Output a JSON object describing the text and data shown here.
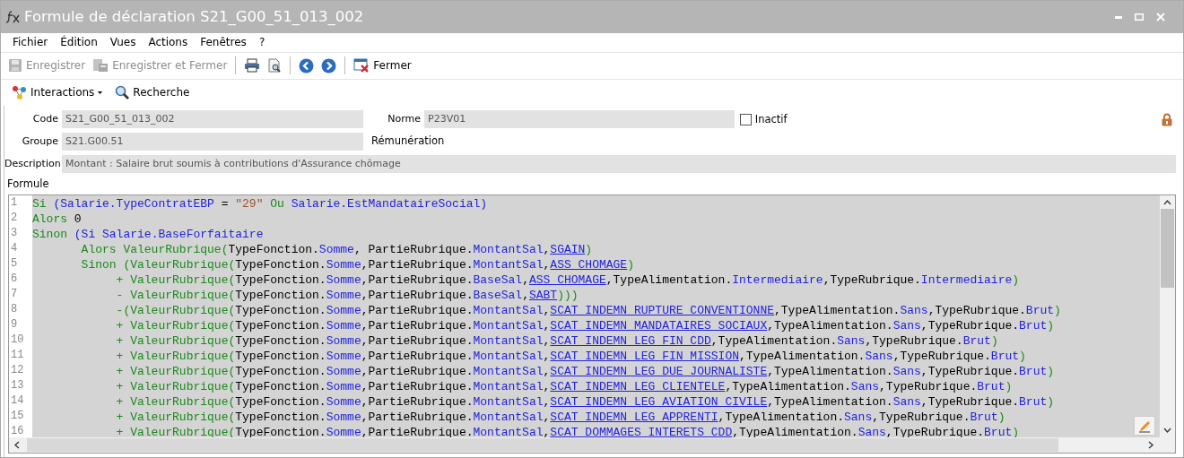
{
  "window": {
    "title": "Formule de déclaration S21_G00_51_013_002"
  },
  "menu": [
    "Fichier",
    "Édition",
    "Vues",
    "Actions",
    "Fenêtres",
    "?"
  ],
  "toolbar": [
    {
      "kind": "save",
      "label": "Enregistrer",
      "disabled": true
    },
    {
      "kind": "save-close",
      "label": "Enregistrer et Fermer",
      "disabled": true
    },
    {
      "kind": "sep"
    },
    {
      "kind": "print"
    },
    {
      "kind": "preview"
    },
    {
      "kind": "sep"
    },
    {
      "kind": "back"
    },
    {
      "kind": "forward"
    },
    {
      "kind": "sep"
    },
    {
      "kind": "close",
      "label": "Fermer",
      "disabled": false
    }
  ],
  "toolbar2": [
    {
      "kind": "interactions",
      "label": "Interactions"
    },
    {
      "kind": "search",
      "label": "Recherche"
    }
  ],
  "form": {
    "code_label": "Code",
    "code": "S21_G00_51_013_002",
    "norme_label": "Norme",
    "norme": "P23V01",
    "inactif_label": "Inactif",
    "inactif_checked": false,
    "groupe_label": "Groupe",
    "groupe": "S21.G00.51",
    "groupe_name": "Rémunération",
    "description_label": "Description",
    "description": "Montant : Salaire brut soumis à contributions d'Assurance chômage",
    "formule_label": "Formule"
  },
  "code_lines": [
    {
      "number": "1",
      "tokens": [
        {
          "kind": "kw",
          "text": "Si "
        },
        {
          "kind": "mem",
          "text": "(Salarie.TypeContratEBP"
        },
        {
          "kind": "ty",
          "text": " = "
        },
        {
          "kind": "str",
          "text": "\"29\""
        },
        {
          "kind": "kw",
          "text": " Ou "
        },
        {
          "kind": "mem",
          "text": "Salarie.EstMandataireSocial)"
        }
      ]
    },
    {
      "number": "2",
      "tokens": [
        {
          "kind": "kw",
          "text": "Alors "
        },
        {
          "kind": "ty",
          "text": "0"
        }
      ]
    },
    {
      "number": "3",
      "tokens": [
        {
          "kind": "kw",
          "text": "Sinon "
        },
        {
          "kind": "mem",
          "text": "(Si Salarie.BaseForfaitaire"
        }
      ]
    },
    {
      "number": "4",
      "tokens": [
        {
          "kind": "kw",
          "text": "       Alors ValeurRubrique("
        },
        {
          "kind": "ty",
          "text": "TypeFonction."
        },
        {
          "kind": "mem",
          "text": "Somme"
        },
        {
          "kind": "ty",
          "text": ", PartieRubrique."
        },
        {
          "kind": "mem",
          "text": "MontantSal"
        },
        {
          "kind": "ty",
          "text": ","
        },
        {
          "kind": "link",
          "text": "SGAIN"
        },
        {
          "kind": "kw",
          "text": ")"
        }
      ]
    },
    {
      "number": "5",
      "tokens": [
        {
          "kind": "kw",
          "text": "       Sinon (ValeurRubrique("
        },
        {
          "kind": "ty",
          "text": "TypeFonction."
        },
        {
          "kind": "mem",
          "text": "Somme"
        },
        {
          "kind": "ty",
          "text": ",PartieRubrique."
        },
        {
          "kind": "mem",
          "text": "MontantSal"
        },
        {
          "kind": "ty",
          "text": ","
        },
        {
          "kind": "link",
          "text": "ASS_CHOMAGE"
        },
        {
          "kind": "kw",
          "text": ")"
        }
      ]
    },
    {
      "number": "6",
      "tokens": [
        {
          "kind": "kw",
          "text": "            + ValeurRubrique("
        },
        {
          "kind": "ty",
          "text": "TypeFonction."
        },
        {
          "kind": "mem",
          "text": "Somme"
        },
        {
          "kind": "ty",
          "text": ",PartieRubrique."
        },
        {
          "kind": "mem",
          "text": "BaseSal"
        },
        {
          "kind": "ty",
          "text": ","
        },
        {
          "kind": "link",
          "text": "ASS_CHOMAGE"
        },
        {
          "kind": "ty",
          "text": ",TypeAlimentation."
        },
        {
          "kind": "mem",
          "text": "Intermediaire"
        },
        {
          "kind": "ty",
          "text": ",TypeRubrique."
        },
        {
          "kind": "mem",
          "text": "Intermediaire"
        },
        {
          "kind": "kw",
          "text": ")"
        }
      ]
    },
    {
      "number": "7",
      "tokens": [
        {
          "kind": "kw",
          "text": "            - ValeurRubrique("
        },
        {
          "kind": "ty",
          "text": "TypeFonction."
        },
        {
          "kind": "mem",
          "text": "Somme"
        },
        {
          "kind": "ty",
          "text": ",PartieRubrique."
        },
        {
          "kind": "mem",
          "text": "BaseSal"
        },
        {
          "kind": "ty",
          "text": ","
        },
        {
          "kind": "link",
          "text": "SABT"
        },
        {
          "kind": "kw",
          "text": ")))"
        }
      ]
    },
    {
      "number": "8",
      "tokens": [
        {
          "kind": "kw",
          "text": "            -(ValeurRubrique("
        },
        {
          "kind": "ty",
          "text": "TypeFonction."
        },
        {
          "kind": "mem",
          "text": "Somme"
        },
        {
          "kind": "ty",
          "text": ",PartieRubrique."
        },
        {
          "kind": "mem",
          "text": "MontantSal"
        },
        {
          "kind": "ty",
          "text": ","
        },
        {
          "kind": "link",
          "text": "SCAT_INDEMN_RUPTURE_CONVENTIONNE"
        },
        {
          "kind": "ty",
          "text": ",TypeAlimentation."
        },
        {
          "kind": "mem",
          "text": "Sans"
        },
        {
          "kind": "ty",
          "text": ",TypeRubrique."
        },
        {
          "kind": "mem",
          "text": "Brut"
        },
        {
          "kind": "kw",
          "text": ")"
        }
      ]
    },
    {
      "number": "9",
      "tokens": [
        {
          "kind": "kw",
          "text": "            + ValeurRubrique("
        },
        {
          "kind": "ty",
          "text": "TypeFonction."
        },
        {
          "kind": "mem",
          "text": "Somme"
        },
        {
          "kind": "ty",
          "text": ",PartieRubrique."
        },
        {
          "kind": "mem",
          "text": "MontantSal"
        },
        {
          "kind": "ty",
          "text": ","
        },
        {
          "kind": "link",
          "text": "SCAT_INDEMN_MANDATAIRES_SOCIAUX"
        },
        {
          "kind": "ty",
          "text": ",TypeAlimentation."
        },
        {
          "kind": "mem",
          "text": "Sans"
        },
        {
          "kind": "ty",
          "text": ",TypeRubrique."
        },
        {
          "kind": "mem",
          "text": "Brut"
        },
        {
          "kind": "kw",
          "text": ")"
        }
      ]
    },
    {
      "number": "10",
      "tokens": [
        {
          "kind": "kw",
          "text": "            + ValeurRubrique("
        },
        {
          "kind": "ty",
          "text": "TypeFonction."
        },
        {
          "kind": "mem",
          "text": "Somme"
        },
        {
          "kind": "ty",
          "text": ",PartieRubrique."
        },
        {
          "kind": "mem",
          "text": "MontantSal"
        },
        {
          "kind": "ty",
          "text": ","
        },
        {
          "kind": "link",
          "text": "SCAT_INDEMN_LEG_FIN_CDD"
        },
        {
          "kind": "ty",
          "text": ",TypeAlimentation."
        },
        {
          "kind": "mem",
          "text": "Sans"
        },
        {
          "kind": "ty",
          "text": ",TypeRubrique."
        },
        {
          "kind": "mem",
          "text": "Brut"
        },
        {
          "kind": "kw",
          "text": ")"
        }
      ]
    },
    {
      "number": "11",
      "tokens": [
        {
          "kind": "kw",
          "text": "            + ValeurRubrique("
        },
        {
          "kind": "ty",
          "text": "TypeFonction."
        },
        {
          "kind": "mem",
          "text": "Somme"
        },
        {
          "kind": "ty",
          "text": ",PartieRubrique."
        },
        {
          "kind": "mem",
          "text": "MontantSal"
        },
        {
          "kind": "ty",
          "text": ","
        },
        {
          "kind": "link",
          "text": "SCAT_INDEMN_LEG_FIN_MISSION"
        },
        {
          "kind": "ty",
          "text": ",TypeAlimentation."
        },
        {
          "kind": "mem",
          "text": "Sans"
        },
        {
          "kind": "ty",
          "text": ",TypeRubrique."
        },
        {
          "kind": "mem",
          "text": "Brut"
        },
        {
          "kind": "kw",
          "text": ")"
        }
      ]
    },
    {
      "number": "12",
      "tokens": [
        {
          "kind": "kw",
          "text": "            + ValeurRubrique("
        },
        {
          "kind": "ty",
          "text": "TypeFonction."
        },
        {
          "kind": "mem",
          "text": "Somme"
        },
        {
          "kind": "ty",
          "text": ",PartieRubrique."
        },
        {
          "kind": "mem",
          "text": "MontantSal"
        },
        {
          "kind": "ty",
          "text": ","
        },
        {
          "kind": "link",
          "text": "SCAT_INDEMN_LEG_DUE_JOURNALISTE"
        },
        {
          "kind": "ty",
          "text": ",TypeAlimentation."
        },
        {
          "kind": "mem",
          "text": "Sans"
        },
        {
          "kind": "ty",
          "text": ",TypeRubrique."
        },
        {
          "kind": "mem",
          "text": "Brut"
        },
        {
          "kind": "kw",
          "text": ")"
        }
      ]
    },
    {
      "number": "13",
      "tokens": [
        {
          "kind": "kw",
          "text": "            + ValeurRubrique("
        },
        {
          "kind": "ty",
          "text": "TypeFonction."
        },
        {
          "kind": "mem",
          "text": "Somme"
        },
        {
          "kind": "ty",
          "text": ",PartieRubrique."
        },
        {
          "kind": "mem",
          "text": "MontantSal"
        },
        {
          "kind": "ty",
          "text": ","
        },
        {
          "kind": "link",
          "text": "SCAT_INDEMN_LEG_CLIENTELE"
        },
        {
          "kind": "ty",
          "text": ",TypeAlimentation."
        },
        {
          "kind": "mem",
          "text": "Sans"
        },
        {
          "kind": "ty",
          "text": ",TypeRubrique."
        },
        {
          "kind": "mem",
          "text": "Brut"
        },
        {
          "kind": "kw",
          "text": ")"
        }
      ]
    },
    {
      "number": "14",
      "tokens": [
        {
          "kind": "kw",
          "text": "            + ValeurRubrique("
        },
        {
          "kind": "ty",
          "text": "TypeFonction."
        },
        {
          "kind": "mem",
          "text": "Somme"
        },
        {
          "kind": "ty",
          "text": ",PartieRubrique."
        },
        {
          "kind": "mem",
          "text": "MontantSal"
        },
        {
          "kind": "ty",
          "text": ","
        },
        {
          "kind": "link",
          "text": "SCAT_INDEMN_LEG_AVIATION_CIVILE"
        },
        {
          "kind": "ty",
          "text": ",TypeAlimentation."
        },
        {
          "kind": "mem",
          "text": "Sans"
        },
        {
          "kind": "ty",
          "text": ",TypeRubrique."
        },
        {
          "kind": "mem",
          "text": "Brut"
        },
        {
          "kind": "kw",
          "text": ")"
        }
      ]
    },
    {
      "number": "15",
      "tokens": [
        {
          "kind": "kw",
          "text": "            + ValeurRubrique("
        },
        {
          "kind": "ty",
          "text": "TypeFonction."
        },
        {
          "kind": "mem",
          "text": "Somme"
        },
        {
          "kind": "ty",
          "text": ",PartieRubrique."
        },
        {
          "kind": "mem",
          "text": "MontantSal"
        },
        {
          "kind": "ty",
          "text": ","
        },
        {
          "kind": "link",
          "text": "SCAT_INDEMN_LEG_APPRENTI"
        },
        {
          "kind": "ty",
          "text": ",TypeAlimentation."
        },
        {
          "kind": "mem",
          "text": "Sans"
        },
        {
          "kind": "ty",
          "text": ",TypeRubrique."
        },
        {
          "kind": "mem",
          "text": "Brut"
        },
        {
          "kind": "kw",
          "text": ")"
        }
      ]
    },
    {
      "number": "16",
      "tokens": [
        {
          "kind": "kw",
          "text": "            + ValeurRubrique("
        },
        {
          "kind": "ty",
          "text": "TypeFonction."
        },
        {
          "kind": "mem",
          "text": "Somme"
        },
        {
          "kind": "ty",
          "text": ",PartieRubrique."
        },
        {
          "kind": "mem",
          "text": "MontantSal"
        },
        {
          "kind": "ty",
          "text": ","
        },
        {
          "kind": "link",
          "text": "SCAT_DOMMAGES_INTERETS_CDD"
        },
        {
          "kind": "ty",
          "text": ",TypeAlimentation."
        },
        {
          "kind": "mem",
          "text": "Sans"
        },
        {
          "kind": "ty",
          "text": ",TypeRubrique."
        },
        {
          "kind": "mem",
          "text": "Brut"
        },
        {
          "kind": "kw",
          "text": ")"
        }
      ]
    }
  ]
}
